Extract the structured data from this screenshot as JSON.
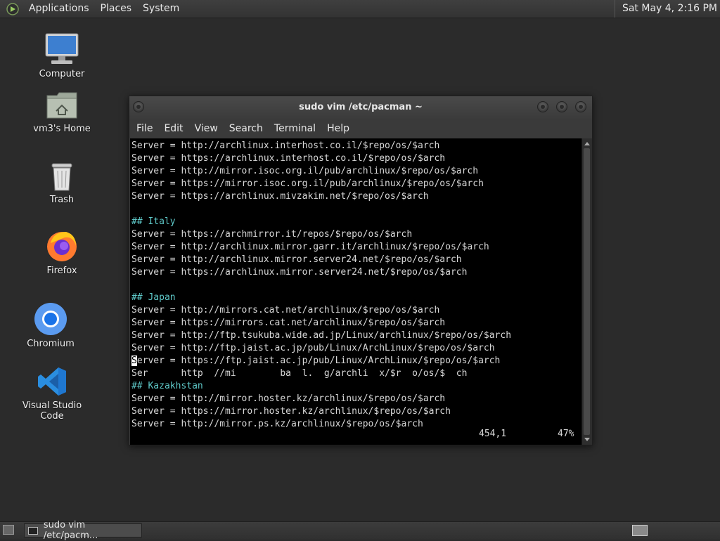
{
  "top_panel": {
    "menus": [
      "Applications",
      "Places",
      "System"
    ],
    "clock": "Sat May  4,  2:16 PM"
  },
  "desktop": {
    "icons": [
      {
        "label": "Computer",
        "icon": "computer-icon"
      },
      {
        "label": "vm3's Home",
        "icon": "home-folder-icon"
      },
      {
        "label": "Trash",
        "icon": "trash-icon"
      },
      {
        "label": "Firefox",
        "icon": "firefox-icon"
      },
      {
        "label": "Chromium",
        "icon": "chromium-icon"
      },
      {
        "label": "Visual Studio Code",
        "icon": "vscode-icon"
      }
    ]
  },
  "terminal": {
    "title": "sudo vim /etc/pacman ~",
    "menu": [
      "File",
      "Edit",
      "View",
      "Search",
      "Terminal",
      "Help"
    ],
    "lines": [
      "Server = http://archlinux.interhost.co.il/$repo/os/$arch",
      "Server = https://archlinux.interhost.co.il/$repo/os/$arch",
      "Server = http://mirror.isoc.org.il/pub/archlinux/$repo/os/$arch",
      "Server = https://mirror.isoc.org.il/pub/archlinux/$repo/os/$arch",
      "Server = https://archlinux.mivzakim.net/$repo/os/$arch",
      "",
      "## Italy",
      "Server = https://archmirror.it/repos/$repo/os/$arch",
      "Server = http://archlinux.mirror.garr.it/archlinux/$repo/os/$arch",
      "Server = http://archlinux.mirror.server24.net/$repo/os/$arch",
      "Server = https://archlinux.mirror.server24.net/$repo/os/$arch",
      "",
      "## Japan",
      "Server = http://mirrors.cat.net/archlinux/$repo/os/$arch",
      "Server = https://mirrors.cat.net/archlinux/$repo/os/$arch",
      "Server = http://ftp.tsukuba.wide.ad.jp/Linux/archlinux/$repo/os/$arch",
      "Server = http://ftp.jaist.ac.jp/pub/Linux/ArchLinux/$repo/os/$arch",
      "Server = https://ftp.jaist.ac.jp/pub/Linux/ArchLinux/$repo/os/$arch",
      "Ser      http  //mi        ba  l.  g/archli  x/$r  o/os/$  ch",
      "## Kazakhstan",
      "Server = http://mirror.hoster.kz/archlinux/$repo/os/$arch",
      "Server = https://mirror.hoster.kz/archlinux/$repo/os/$arch",
      "Server = http://mirror.ps.kz/archlinux/$repo/os/$arch"
    ],
    "cursor_line": 17,
    "status_position": "454,1",
    "status_percent": "47%"
  },
  "taskbar": {
    "task_label": "sudo vim /etc/pacm..."
  }
}
